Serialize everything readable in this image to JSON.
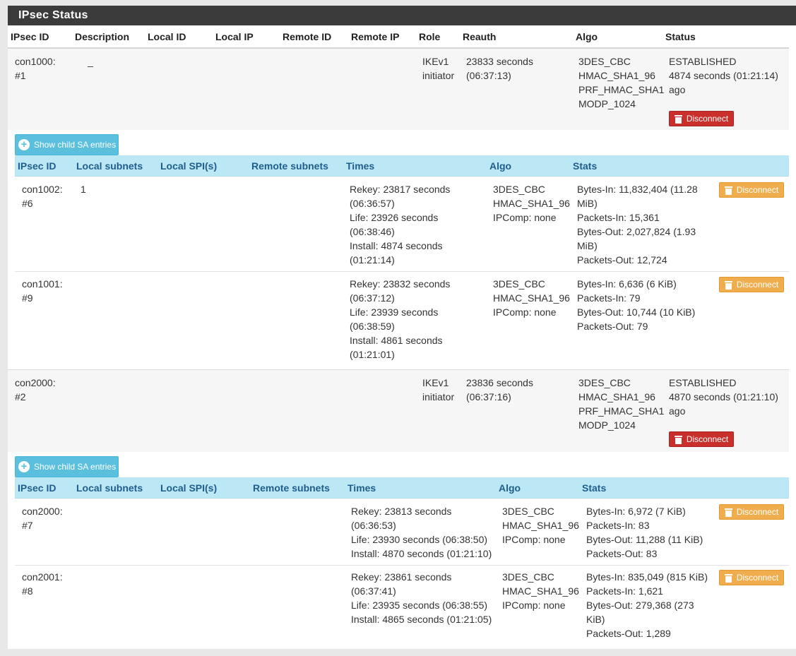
{
  "panel_title": "IPsec Status",
  "main_headers": {
    "ipsec_id": "IPsec ID",
    "description": "Description",
    "local_id": "Local ID",
    "local_ip": "Local IP",
    "remote_id": "Remote ID",
    "remote_ip": "Remote IP",
    "role": "Role",
    "reauth": "Reauth",
    "algo": "Algo",
    "status": "Status"
  },
  "child_headers": {
    "ipsec_id": "IPsec ID",
    "local_subnets": "Local subnets",
    "local_spis": "Local SPI(s)",
    "remote_subnets": "Remote subnets",
    "times": "Times",
    "algo": "Algo",
    "stats": "Stats"
  },
  "show_child_label": "Show child SA entries",
  "disconnect_label": "Disconnect",
  "connections": [
    {
      "id": [
        "con1000:",
        "#1"
      ],
      "description": "_",
      "role": [
        "IKEv1",
        "initiator"
      ],
      "reauth": [
        "23833 seconds",
        "(06:37:13)"
      ],
      "algo": [
        "3DES_CBC",
        "HMAC_SHA1_96",
        "PRF_HMAC_SHA1",
        "MODP_1024"
      ],
      "status": [
        "ESTABLISHED",
        "4874 seconds (01:21:14)",
        "ago"
      ],
      "children": [
        {
          "id": [
            "con1002:",
            "#6"
          ],
          "local_subnets": "1",
          "times": [
            "Rekey: 23817 seconds",
            "(06:36:57)",
            "Life: 23926 seconds",
            "(06:38:46)",
            "Install: 4874 seconds",
            "(01:21:14)"
          ],
          "algo": [
            "3DES_CBC",
            "HMAC_SHA1_96",
            "IPComp: none"
          ],
          "stats": [
            "Bytes-In: 11,832,404 (11.28",
            "MiB)",
            "Packets-In: 15,361",
            "Bytes-Out: 2,027,824 (1.93",
            "MiB)",
            "Packets-Out: 12,724"
          ]
        },
        {
          "id": [
            "con1001:",
            "#9"
          ],
          "local_subnets": "",
          "times": [
            "Rekey: 23832 seconds",
            "(06:37:12)",
            "Life: 23939 seconds",
            "(06:38:59)",
            "Install: 4861 seconds",
            "(01:21:01)"
          ],
          "algo": [
            "3DES_CBC",
            "HMAC_SHA1_96",
            "IPComp: none"
          ],
          "stats": [
            "Bytes-In: 6,636 (6 KiB)",
            "Packets-In: 79",
            "Bytes-Out: 10,744 (10 KiB)",
            "Packets-Out: 79"
          ]
        }
      ]
    },
    {
      "id": [
        "con2000:",
        "#2"
      ],
      "description": "",
      "role": [
        "IKEv1",
        "initiator"
      ],
      "reauth": [
        "23836 seconds",
        "(06:37:16)"
      ],
      "algo": [
        "3DES_CBC",
        "HMAC_SHA1_96",
        "PRF_HMAC_SHA1",
        "MODP_1024"
      ],
      "status": [
        "ESTABLISHED",
        "4870 seconds (01:21:10)",
        "ago"
      ],
      "children": [
        {
          "id": [
            "con2000:",
            "#7"
          ],
          "local_subnets": "",
          "times": [
            "Rekey: 23813 seconds",
            "(06:36:53)",
            "Life: 23930 seconds (06:38:50)",
            "Install: 4870 seconds (01:21:10)"
          ],
          "algo": [
            "3DES_CBC",
            "HMAC_SHA1_96",
            "IPComp: none"
          ],
          "stats": [
            "Bytes-In: 6,972 (7 KiB)",
            "Packets-In: 83",
            "Bytes-Out: 11,288 (11 KiB)",
            "Packets-Out: 83"
          ]
        },
        {
          "id": [
            "con2001:",
            "#8"
          ],
          "local_subnets": "",
          "times": [
            "Rekey: 23861 seconds",
            "(06:37:41)",
            "Life: 23935 seconds (06:38:55)",
            "Install: 4865 seconds (01:21:05)"
          ],
          "algo": [
            "3DES_CBC",
            "HMAC_SHA1_96",
            "IPComp: none"
          ],
          "stats": [
            "Bytes-In: 835,049 (815 KiB)",
            "Packets-In: 1,621",
            "Bytes-Out: 279,368 (273",
            "KiB)",
            "Packets-Out: 1,289"
          ]
        }
      ]
    }
  ]
}
